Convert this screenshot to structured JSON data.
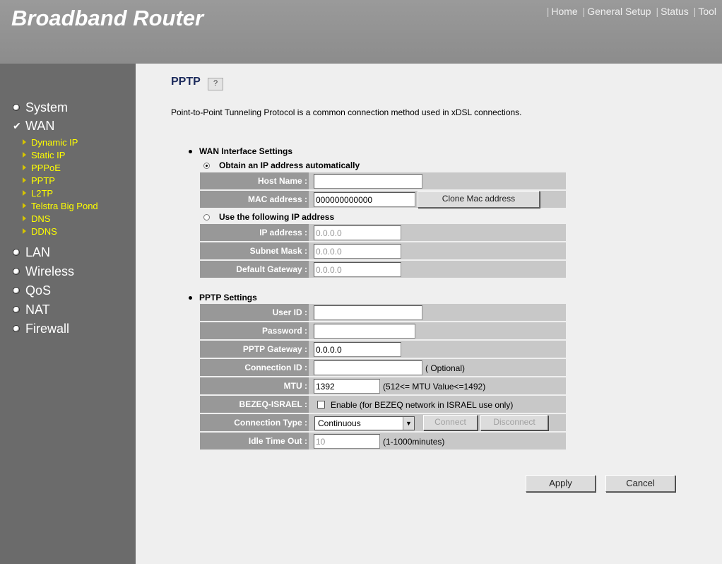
{
  "header": {
    "brand": "Broadband Router",
    "nav": [
      "Home",
      "General Setup",
      "Status",
      "Tool"
    ]
  },
  "sidebar": {
    "main": [
      {
        "label": "System",
        "marker": "bullet-icon"
      },
      {
        "label": "WAN",
        "marker": "checkmark-icon"
      },
      {
        "label": "LAN",
        "marker": "bullet-icon"
      },
      {
        "label": "Wireless",
        "marker": "bullet-icon"
      },
      {
        "label": "QoS",
        "marker": "bullet-icon"
      },
      {
        "label": "NAT",
        "marker": "bullet-icon"
      },
      {
        "label": "Firewall",
        "marker": "bullet-icon"
      }
    ],
    "wan_sub": [
      "Dynamic IP",
      "Static IP",
      "PPPoE",
      "PPTP",
      "L2TP",
      "Telstra Big Pond",
      "DNS",
      "DDNS"
    ]
  },
  "page": {
    "title": "PPTP",
    "help_icon": "help-icon",
    "description": "Point-to-Point Tunneling Protocol is a common connection method used in xDSL connections."
  },
  "wan": {
    "section_label": "WAN Interface Settings",
    "radio_auto": "Obtain an IP address automatically",
    "radio_auto_selected": true,
    "host_name_label": "Host Name :",
    "host_name_value": "",
    "mac_label": "MAC address :",
    "mac_value": "000000000000",
    "clone_mac_button": "Clone Mac address",
    "radio_static": "Use the following IP address",
    "ip_label": "IP address :",
    "ip_value": "0.0.0.0",
    "mask_label": "Subnet Mask :",
    "mask_value": "0.0.0.0",
    "gateway_label": "Default Gateway :",
    "gateway_value": "0.0.0.0"
  },
  "pptp": {
    "section_label": "PPTP Settings",
    "user_id_label": "User ID :",
    "user_id_value": "",
    "password_label": "Password :",
    "password_value": "",
    "gateway_label": "PPTP Gateway :",
    "gateway_value": "0.0.0.0",
    "conn_id_label": "Connection ID :",
    "conn_id_value": "",
    "conn_id_note": "( Optional)",
    "mtu_label": "MTU :",
    "mtu_value": "1392",
    "mtu_note": "(512<= MTU Value<=1492)",
    "bezeq_label": "BEZEQ-ISRAEL :",
    "bezeq_check_label": "Enable (for BEZEQ network in ISRAEL use only)",
    "bezeq_checked": false,
    "conn_type_label": "Connection Type :",
    "conn_type_value": "Continuous",
    "connect_button": "Connect",
    "disconnect_button": "Disconnect",
    "idle_label": "Idle Time Out :",
    "idle_value": "10",
    "idle_note": "(1-1000minutes)"
  },
  "actions": {
    "apply": "Apply",
    "cancel": "Cancel"
  }
}
